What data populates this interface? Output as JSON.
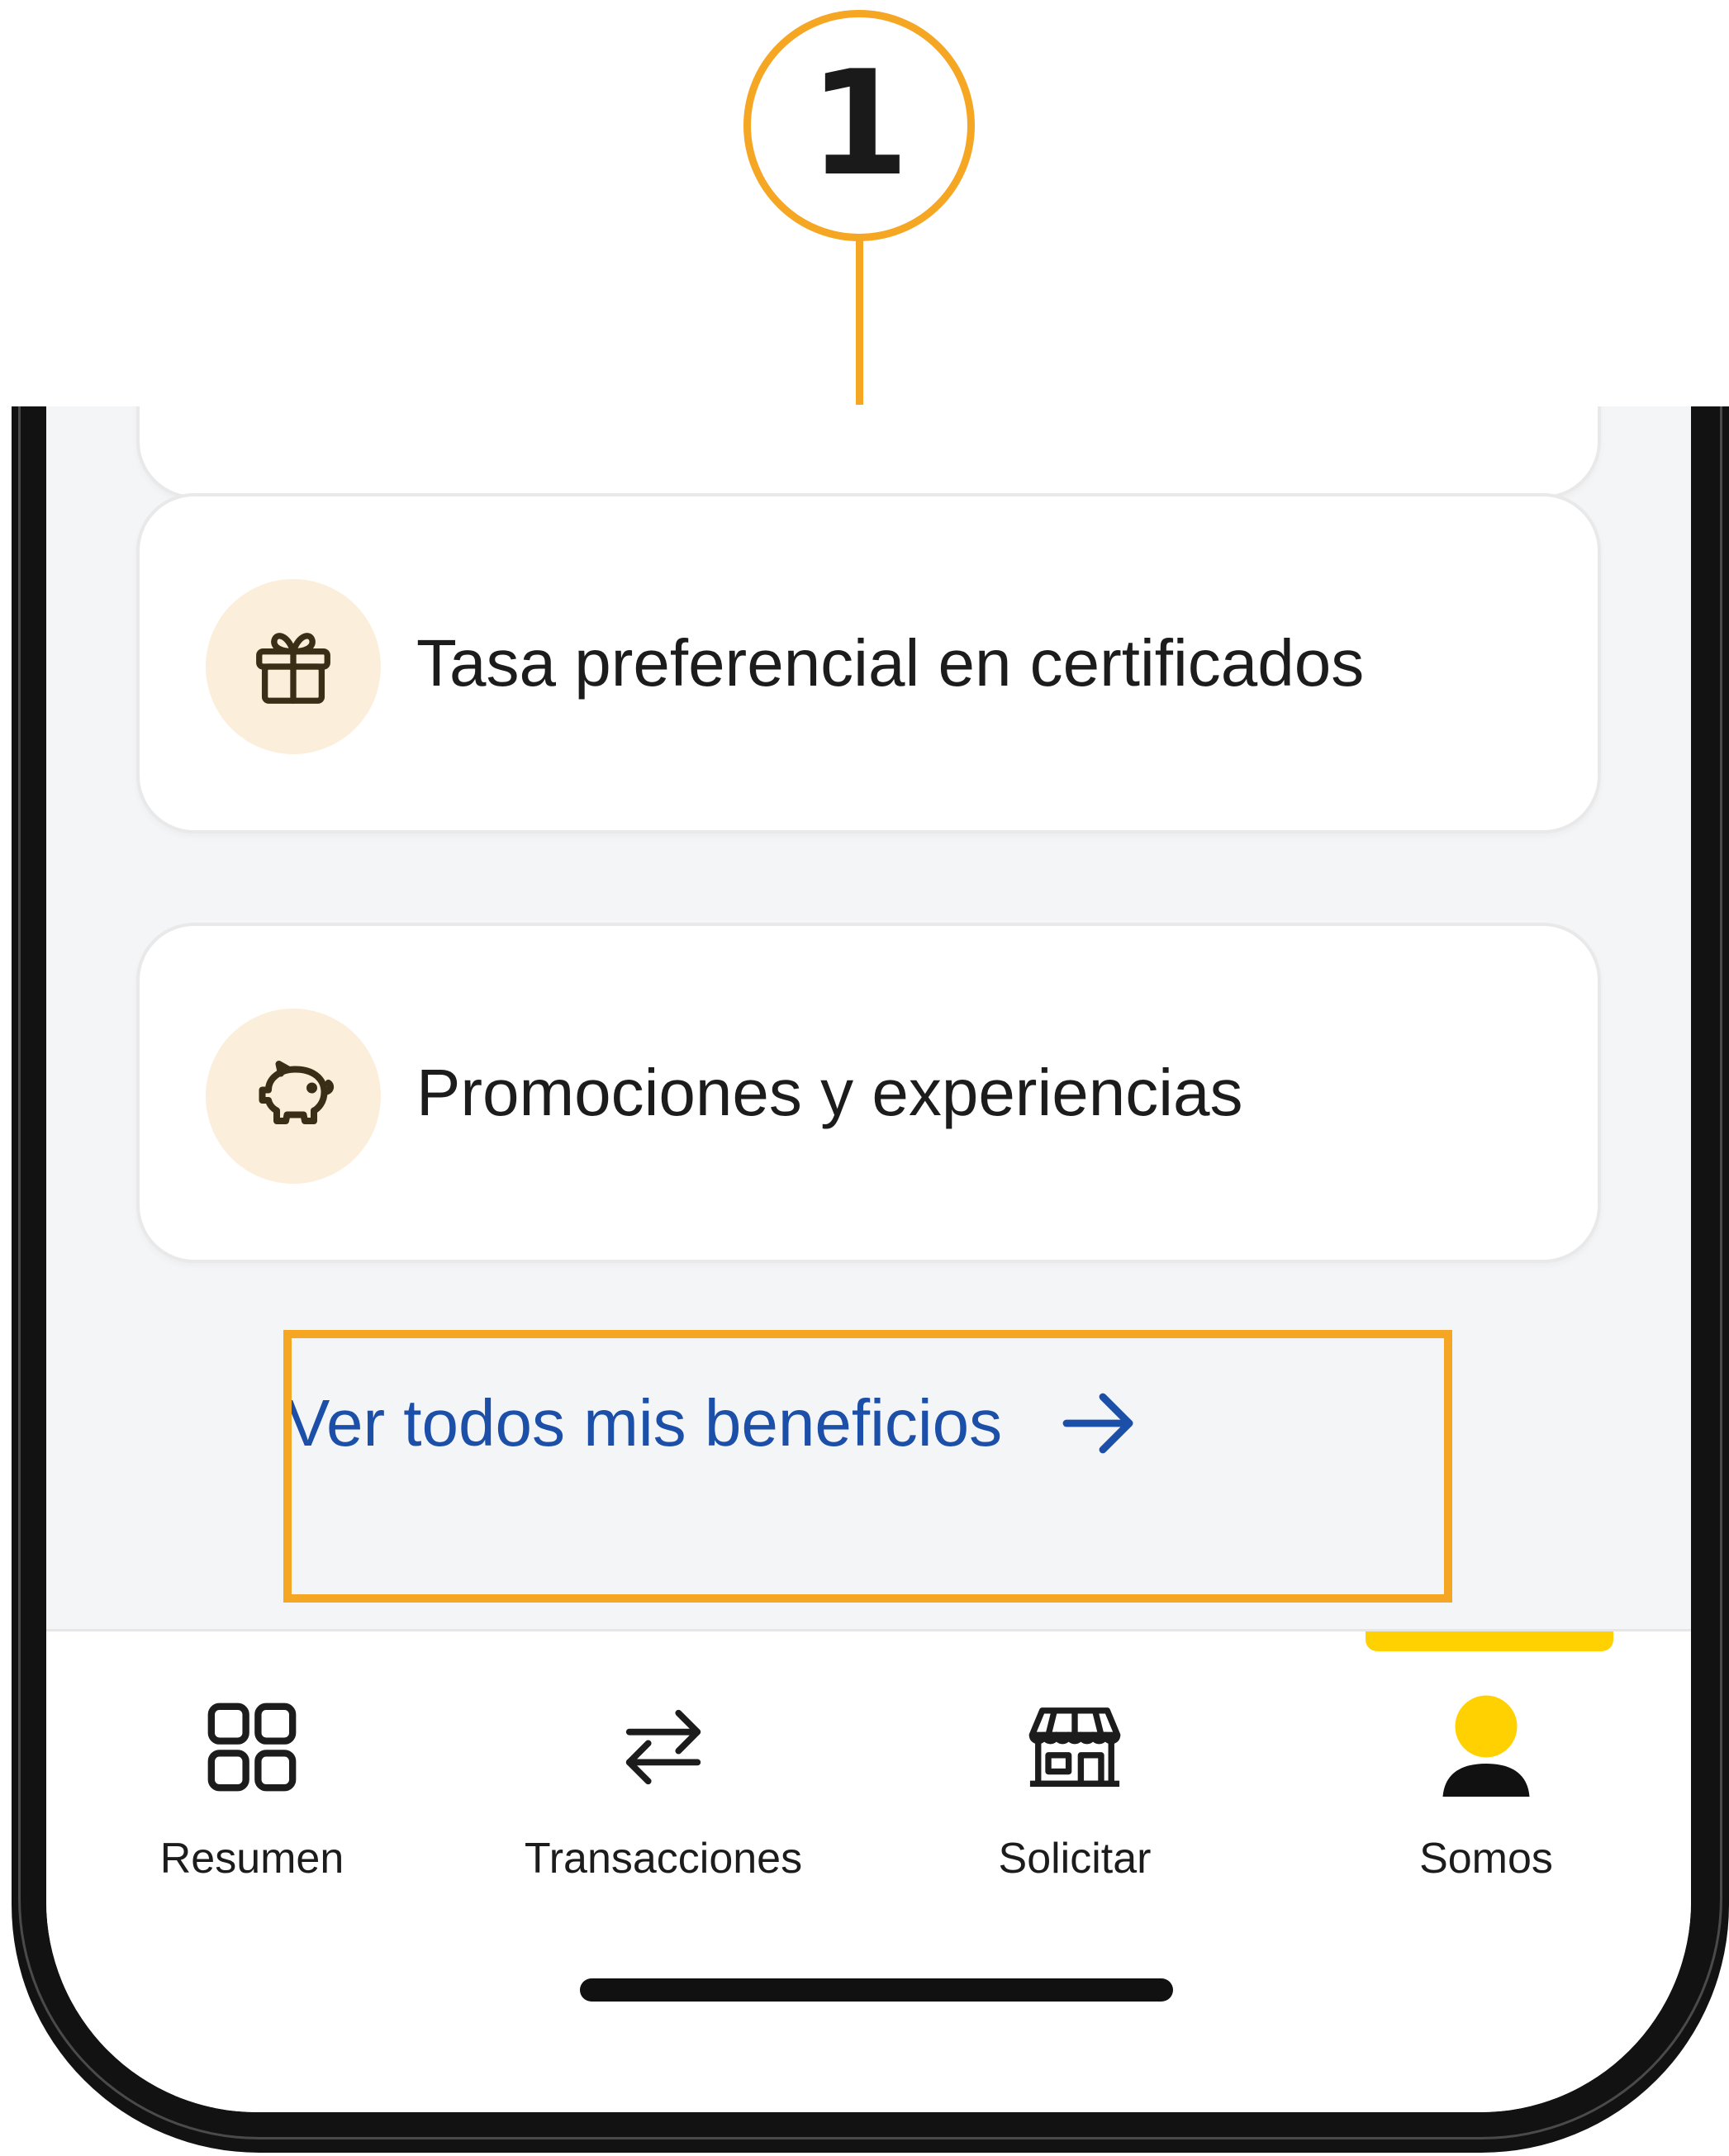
{
  "callout": {
    "number": "1"
  },
  "benefits": [
    {
      "label": "Tasa preferencial en certificados",
      "icon": "gift-icon"
    },
    {
      "label": "Promociones y experiencias",
      "icon": "piggy-bank-icon"
    }
  ],
  "view_all": {
    "label": "Ver todos mis beneficios",
    "icon": "arrow-right-icon"
  },
  "nav": {
    "items": [
      {
        "label": "Resumen",
        "icon": "grid-icon"
      },
      {
        "label": "Transacciones",
        "icon": "transfer-arrows-icon"
      },
      {
        "label": "Solicitar",
        "icon": "store-icon"
      },
      {
        "label": "Somos",
        "icon": "user-avatar-icon"
      }
    ],
    "active": "Somos"
  },
  "colors": {
    "accent_callout": "#F5A623",
    "link_blue": "#1B4FA8",
    "active_yellow": "#FFD100",
    "icon_bg": "#FBEFDC",
    "icon_stroke": "#3B2E16"
  }
}
